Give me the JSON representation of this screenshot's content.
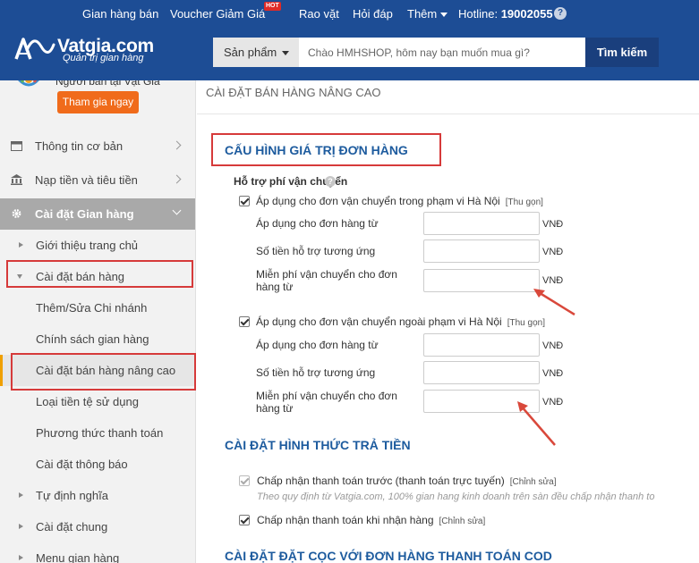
{
  "topnav": {
    "items": [
      "Gian hàng bán",
      "Voucher Giảm Giá",
      "Rao vặt",
      "Hỏi đáp",
      "Thêm"
    ],
    "hot_badge": "HOT",
    "hotline_label": "Hotline:",
    "hotline_number": "19002055",
    "help_glyph": "?"
  },
  "brand": {
    "name": "Vatgia.com",
    "slogan": "Quản trị gian hàng"
  },
  "search": {
    "category": "Sản phẩm",
    "placeholder": "Chào HMHSHOP, hôm nay bạn muốn mua gì?",
    "button": "Tìm kiếm"
  },
  "sidebar": {
    "profile_name": "Người bán tại Vật Giá",
    "join_button": "Tham gia ngay",
    "items": [
      {
        "label": "Thông tin cơ bản",
        "icon": "calendar-icon"
      },
      {
        "label": "Nạp tiền và tiêu tiền",
        "icon": "bank-icon"
      },
      {
        "label": "Cài đặt Gian hàng",
        "icon": "gear-icon"
      },
      {
        "label": "Giới thiệu trang chủ"
      },
      {
        "label": "Cài đặt bán hàng"
      },
      {
        "label": "Thêm/Sửa Chi nhánh"
      },
      {
        "label": "Chính sách gian hàng"
      },
      {
        "label": "Cài đặt bán hàng nâng cao"
      },
      {
        "label": "Loại tiền tệ sử dụng"
      },
      {
        "label": "Phương thức thanh toán"
      },
      {
        "label": "Cài đặt thông báo"
      },
      {
        "label": "Tự định nghĩa"
      },
      {
        "label": "Cài đặt chung"
      },
      {
        "label": "Menu gian hàng"
      }
    ]
  },
  "main": {
    "page_title": "CÀI ĐẶT BÁN HÀNG NÂNG CAO",
    "order_section": {
      "title": "CẤU HÌNH GIÁ TRỊ ĐƠN HÀNG",
      "shipping_support_label": "Hỗ trợ phí vận chuyển",
      "help_glyph": "?",
      "inner": {
        "checkbox_label": "Áp dụng cho đơn vận chuyển trong phạm vi Hà Nội",
        "collapse_link": "[Thu gọn]",
        "fields": [
          {
            "label": "Áp dụng cho đơn hàng từ",
            "value": "",
            "unit": "VNĐ"
          },
          {
            "label": "Số tiền hỗ trợ tương ứng",
            "value": "",
            "unit": "VNĐ"
          },
          {
            "label": "Miễn phí vận chuyển cho đơn hàng từ",
            "value": "",
            "unit": "VNĐ"
          }
        ]
      },
      "outer": {
        "checkbox_label": "Áp dụng cho đơn vận chuyển ngoài phạm vi Hà Nội",
        "collapse_link": "[Thu gọn]",
        "fields": [
          {
            "label": "Áp dụng cho đơn hàng từ",
            "value": "",
            "unit": "VNĐ"
          },
          {
            "label": "Số tiền hỗ trợ tương ứng",
            "value": "",
            "unit": "VNĐ"
          },
          {
            "label": "Miễn phí vận chuyển cho đơn hàng từ",
            "value": "",
            "unit": "VNĐ"
          }
        ]
      }
    },
    "payment_section": {
      "title": "CÀI ĐẶT HÌNH THỨC TRẢ TIỀN",
      "prepay_label": "Chấp nhận thanh toán trước (thanh toán trực tuyến)",
      "prepay_edit": "[Chỉnh sửa]",
      "prepay_note": "Theo quy định từ Vatgia.com, 100% gian hang kinh doanh trên sàn đều chấp nhận thanh to",
      "cod_label": "Chấp nhận thanh toán khi nhận hàng",
      "cod_edit": "[Chỉnh sửa]"
    },
    "deposit_section": {
      "title": "CÀI ĐẶT ĐẶT CỌC VỚI ĐƠN HÀNG THANH TOÁN COD"
    }
  },
  "colors": {
    "header": "#1d4d95",
    "accent_orange": "#f06b1b",
    "highlight_red": "#d63a3a",
    "section_blue": "#1d5b9e"
  }
}
